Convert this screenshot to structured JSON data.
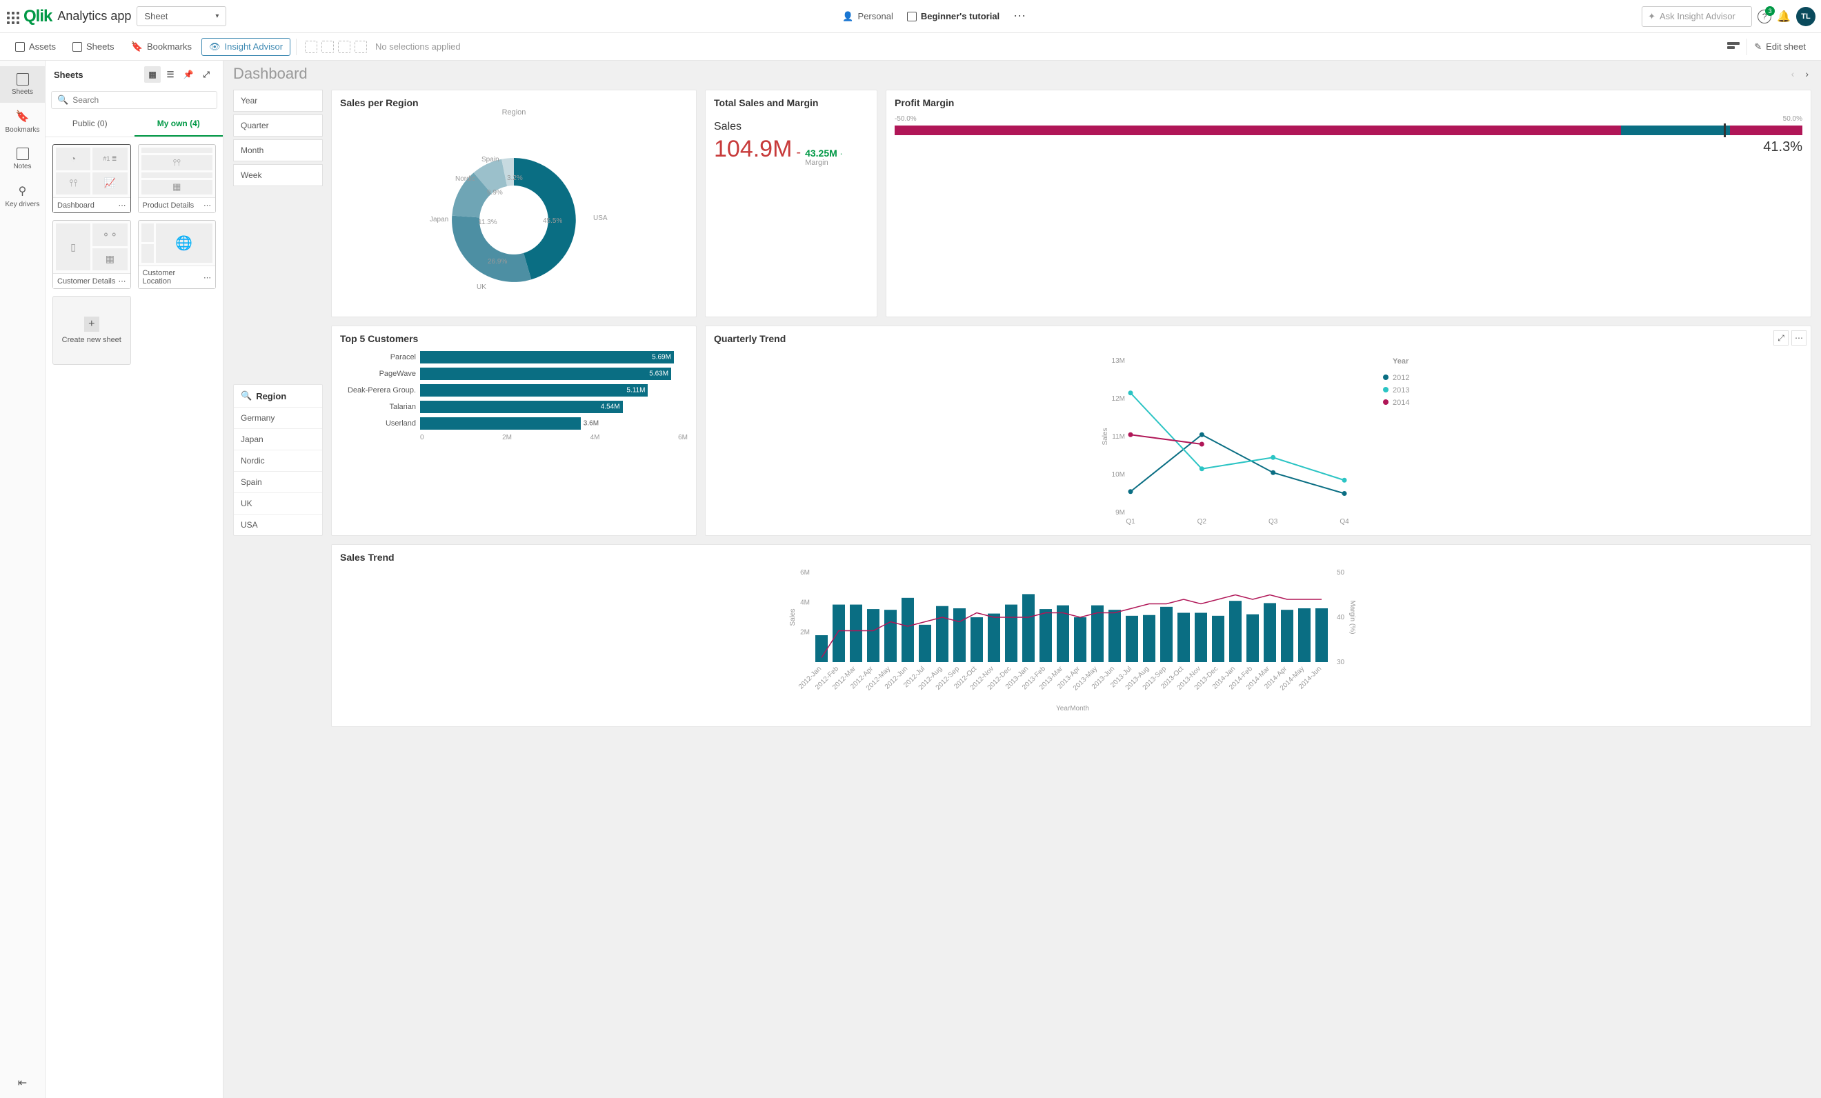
{
  "topbar": {
    "app_title": "Analytics app",
    "sheet_dd": "Sheet",
    "personal": "Personal",
    "tutorial": "Beginner's tutorial",
    "insight_placeholder": "Ask Insight Advisor",
    "help_badge": "3",
    "avatar": "TL"
  },
  "toolbar": {
    "assets": "Assets",
    "sheets": "Sheets",
    "bookmarks": "Bookmarks",
    "insight": "Insight Advisor",
    "nosel": "No selections applied",
    "edit": "Edit sheet"
  },
  "rail": {
    "sheets": "Sheets",
    "bookmarks": "Bookmarks",
    "notes": "Notes",
    "keydrivers": "Key drivers"
  },
  "sheets_panel": {
    "title": "Sheets",
    "search_ph": "Search",
    "tab_public": "Public (0)",
    "tab_own": "My own (4)",
    "thumbs": [
      "Dashboard",
      "Product Details",
      "Customer Details",
      "Customer Location"
    ],
    "new": "Create new sheet"
  },
  "canvas": {
    "title": "Dashboard"
  },
  "periods": [
    "Year",
    "Quarter",
    "Month",
    "Week"
  ],
  "region_filter": {
    "title": "Region",
    "items": [
      "Germany",
      "Japan",
      "Nordic",
      "Spain",
      "UK",
      "USA"
    ]
  },
  "sales_region": {
    "title": "Sales per Region",
    "legend": "Region"
  },
  "kpi": {
    "title": "Total Sales and Margin",
    "label": "Sales",
    "value": "104.9M",
    "delta": "43.25M",
    "delta_dot": "·",
    "sub": "Margin"
  },
  "pm": {
    "title": "Profit Margin",
    "low": "-50.0%",
    "high": "50.0%",
    "value": "41.3%"
  },
  "top5": {
    "title": "Top 5 Customers"
  },
  "qt": {
    "title": "Quarterly Trend",
    "legend": "Year",
    "ylabel": "Sales"
  },
  "st": {
    "title": "Sales Trend",
    "ylabel": "Sales",
    "y2label": "Margin (%)",
    "xlabel": "YearMonth"
  },
  "chart_data": [
    {
      "type": "pie",
      "title": "Sales per Region",
      "categories": [
        "USA",
        "UK",
        "Japan",
        "Nordic",
        "Spain"
      ],
      "values": [
        45.5,
        26.9,
        11.3,
        9.9,
        3.2
      ],
      "hole": 0.55,
      "unit": "%",
      "extra_label": "Spain"
    },
    {
      "type": "bar",
      "title": "Top 5 Customers",
      "categories": [
        "Paracel",
        "PageWave",
        "Deak-Perera Group.",
        "Talarian",
        "Userland"
      ],
      "values": [
        5.69,
        5.63,
        5.11,
        4.54,
        3.6
      ],
      "value_labels": [
        "5.69M",
        "5.63M",
        "5.11M",
        "4.54M",
        "3.6M"
      ],
      "xlim": [
        0,
        6
      ],
      "xticks": [
        "0",
        "2M",
        "4M",
        "6M"
      ],
      "orientation": "horizontal"
    },
    {
      "type": "line",
      "title": "Quarterly Trend",
      "x": [
        "Q1",
        "Q2",
        "Q3",
        "Q4"
      ],
      "series": [
        {
          "name": "2012",
          "values": [
            9.55,
            11.05,
            10.05,
            9.5
          ],
          "color": "#0a6e83"
        },
        {
          "name": "2013",
          "values": [
            12.15,
            10.15,
            10.45,
            9.85
          ],
          "color": "#2bc4c4"
        },
        {
          "name": "2014",
          "values": [
            11.05,
            10.8,
            null,
            null
          ],
          "color": "#b01657"
        }
      ],
      "ylim": [
        9,
        13
      ],
      "yticks": [
        "9M",
        "10M",
        "11M",
        "12M",
        "13M"
      ],
      "ylabel": "Sales"
    },
    {
      "type": "bar",
      "title": "Sales Trend",
      "categories": [
        "2012-Jan",
        "2012-Feb",
        "2012-Mar",
        "2012-Apr",
        "2012-May",
        "2012-Jun",
        "2012-Jul",
        "2012-Aug",
        "2012-Sep",
        "2012-Oct",
        "2012-Nov",
        "2012-Dec",
        "2013-Jan",
        "2013-Feb",
        "2013-Mar",
        "2013-Apr",
        "2013-May",
        "2013-Jun",
        "2013-Jul",
        "2013-Aug",
        "2013-Sep",
        "2013-Oct",
        "2013-Nov",
        "2013-Dec",
        "2014-Jan",
        "2014-Feb",
        "2014-Mar",
        "2014-Apr",
        "2014-May",
        "2014-Jun"
      ],
      "values": [
        1.8,
        3.85,
        3.85,
        3.55,
        3.5,
        4.3,
        2.5,
        3.75,
        3.6,
        3.0,
        3.25,
        3.85,
        4.55,
        3.55,
        3.8,
        3.0,
        3.8,
        3.5,
        3.1,
        3.15,
        3.7,
        3.3,
        3.3,
        3.1,
        4.1,
        3.2,
        3.95,
        3.5,
        3.6,
        3.6
      ],
      "ylim": [
        0,
        6
      ],
      "yticks": [
        "2M",
        "4M",
        "6M"
      ],
      "line_series": {
        "name": "Margin (%)",
        "values": [
          31,
          37,
          37,
          37,
          39,
          38,
          39,
          40,
          39,
          41,
          40,
          40,
          40,
          41,
          41,
          40,
          41,
          41,
          42,
          43,
          43,
          44,
          43,
          44,
          45,
          44,
          45,
          44,
          44,
          44
        ],
        "ylim": [
          30,
          50
        ],
        "yticks": [
          "30",
          "40",
          "50"
        ]
      },
      "xlabel": "YearMonth"
    }
  ]
}
